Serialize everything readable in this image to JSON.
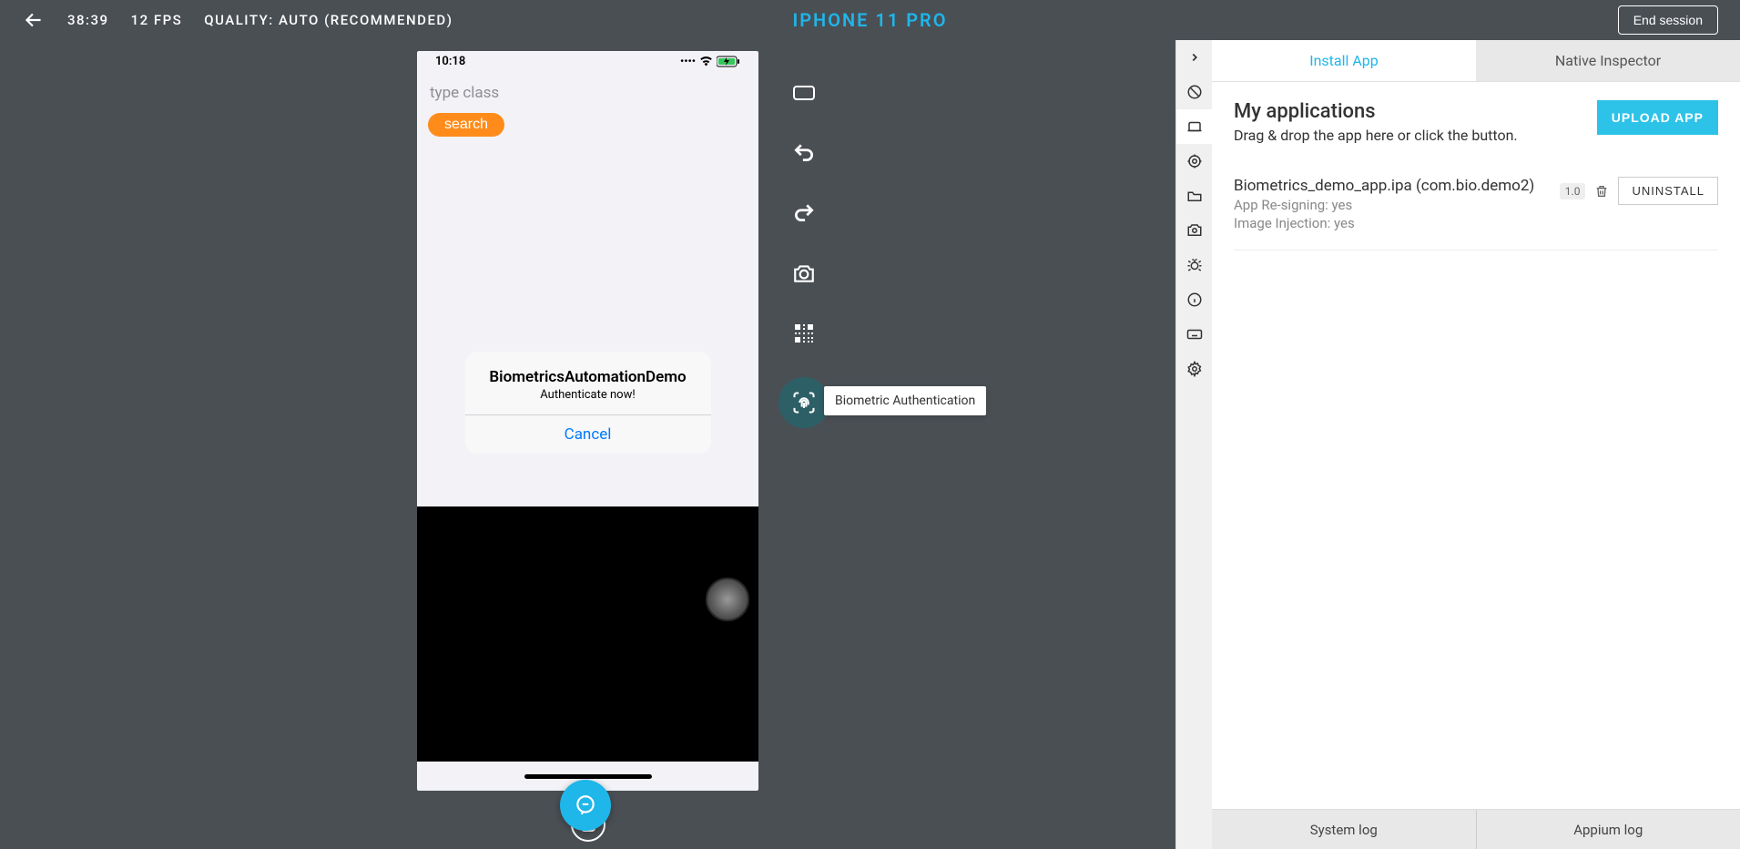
{
  "top_bar": {
    "timer": "38:39",
    "fps": "12 FPS",
    "quality": "QUALITY: AUTO (RECOMMENDED)",
    "device_name": "IPHONE 11 PRO",
    "end_session": "End session"
  },
  "phone": {
    "clock": "10:18",
    "input_placeholder": "type class",
    "search_btn": "search",
    "alert_title": "BiometricsAutomationDemo",
    "alert_message": "Authenticate now!",
    "alert_cancel": "Cancel"
  },
  "toolstrip": {
    "tooltip": "Biometric Authentication"
  },
  "right_panel": {
    "tabs": [
      "Install App",
      "Native Inspector"
    ],
    "apps_title": "My applications",
    "apps_subtitle": "Drag & drop the app here or click the button.",
    "upload": "UPLOAD APP",
    "app": {
      "name": "Biometrics_demo_app.ipa (com.bio.demo2)",
      "resigning": "App Re-signing: yes",
      "image_injection": "Image Injection: yes",
      "version": "1.0",
      "uninstall": "UNINSTALL"
    },
    "footer": [
      "System log",
      "Appium log"
    ]
  }
}
